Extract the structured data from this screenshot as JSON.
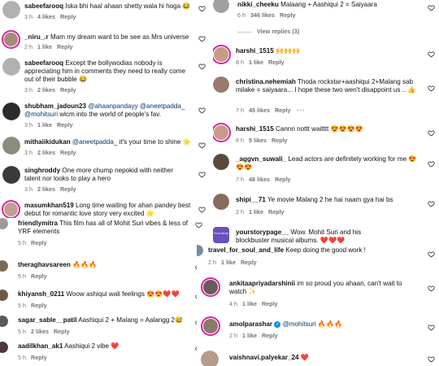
{
  "left_top": {
    "c1": {
      "user": "sabeefarooq",
      "text": "Iska bhi haal ahaan shetty wala hi hoga 😂",
      "time": "3 h",
      "likes": "4 likes",
      "reply": "Reply"
    },
    "c2": {
      "user": "_niru_.r",
      "text": "Mam my dream want to be see as Mrs universe",
      "time": "2 h",
      "likes": "1 like",
      "reply": "Reply"
    },
    "c3": {
      "user": "sabeefarooq",
      "text": "Except the bollywodias nobody is appreciating him in comments they need to really come out of their bubble 😂",
      "time": "3 h",
      "likes": "2 likes",
      "reply": "Reply"
    },
    "c4": {
      "user": "shubham_jadoun23",
      "m1": "@ahaanpandayy",
      "m2": "@aneetpadda_",
      "m3": "@mohitsuri",
      "text": "wlcm into the world of people's fav.",
      "time": "3 h",
      "likes": "1 like",
      "reply": "Reply"
    },
    "c5": {
      "user": "mithaiikidukan",
      "m1": "@aneetpadda_",
      "text": "it's your time to shine 🌟",
      "time": "3 h",
      "likes": "2 likes",
      "reply": "Reply"
    },
    "c6": {
      "user": "singhroddy",
      "text": "One more chump nepokid with neither talent nor looks to play a hero",
      "time": "3 h",
      "likes": "2 likes",
      "reply": "Reply"
    },
    "c7": {
      "user": "masumkhan519",
      "text": "Long time waiting for ahan pandey best debut for romantic love story very excited 🌟",
      "time": "",
      "likes": "",
      "reply": ""
    }
  },
  "left_bottom": {
    "c1": {
      "user": "friendlymitra",
      "text": "This film has all of Mohit Suri vibes & less of YRF elements",
      "time": "5 h",
      "reply": "Reply"
    },
    "c2": {
      "user": "theraghavsareen",
      "text": "🔥🔥🔥",
      "time": "5 h",
      "reply": "Reply"
    },
    "c3": {
      "user": "khiyansh_0211",
      "text": "Woow ashiqui wali feelings 😍😍❤️❤️",
      "time": "5 h",
      "reply": "Reply"
    },
    "c4": {
      "user": "sagar_sable__patil",
      "text": "Aashiqui 2 + Malang = Aalangg 2😅",
      "time": "5 h",
      "likes": "2 likes",
      "reply": "Reply"
    },
    "c5": {
      "user": "aadilkhan_ak1",
      "text": "Aashiqui 2 vibe ❤️",
      "time": "5 h",
      "reply": "Reply"
    }
  },
  "right_top": {
    "c0": {
      "user": "nikki_cheeku",
      "text": "Malaang + Aashiqui 2 = Saiyaara",
      "time": "6 h",
      "likes": "346 likes",
      "reply": "Reply"
    },
    "view_replies": "View replies (3)",
    "c1": {
      "user": "harshi_1515",
      "text": "🙌🙌🙌",
      "time": "8 h",
      "likes": "1 like",
      "reply": "Reply"
    },
    "c2": {
      "user": "christina.nehemiah",
      "text": "Thoda rockstar+aashiqui 2+Malang sab milake = saiyaara... I hope these two wen't disappoint us .. 👍",
      "time": "7 h",
      "likes": "45 likes",
      "reply": "Reply",
      "more": "···"
    },
    "c3": {
      "user": "harshi_1515",
      "text": "Cannn nottt waitttt 😍😍😍😍",
      "time": "8 h",
      "likes": "5 likes",
      "reply": "Reply"
    },
    "c4": {
      "user": "_aggvn_suwali_",
      "text": "Lead actors are definitely working for me 😍😍😍",
      "time": "7 h",
      "likes": "48 likes",
      "reply": "Reply"
    },
    "c5": {
      "user": "shipi__71",
      "text": "Ye movie Malang 2 he hai naam gya hai bs",
      "time": "2 h",
      "likes": "1 like",
      "reply": "Reply"
    },
    "c6": {
      "user": "yourstorypage__",
      "text": "Wow. Mohit Suri and his blockbuster musical albums. ❤️❤️❤️",
      "avatar_text": "Your story"
    }
  },
  "right_bottom": {
    "c1": {
      "user": "travel_for_soul_and_life",
      "text": "Keep doing the good work !",
      "time": "2 h",
      "likes": "1 like",
      "reply": "Reply"
    },
    "c2": {
      "user": "ankitaapriyadarshinii",
      "text": "im so proud you ahaan, can't wait to watch ✨",
      "time": "4 h",
      "likes": "1 like",
      "reply": "Reply"
    },
    "c3": {
      "user": "amolparashar",
      "m1": "@mohitsuri",
      "text": "🔥🔥🔥",
      "time": "2 h",
      "likes": "1 like",
      "reply": "Reply"
    },
    "c4": {
      "user": "vaishnavi.palyekar_24",
      "text": "❤️"
    }
  },
  "colors": {
    "heart_outline": "#262626",
    "mention": "#00376b",
    "meta": "#737373",
    "story_ring": "#d6249f",
    "verified": "#0095f6"
  }
}
